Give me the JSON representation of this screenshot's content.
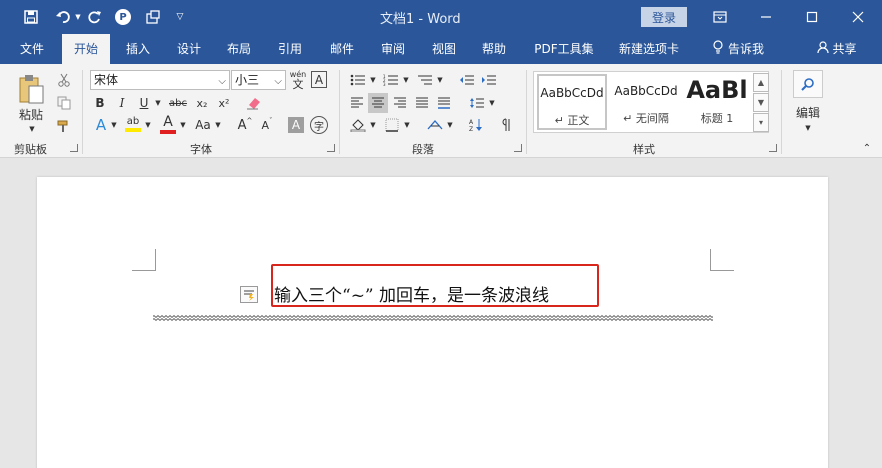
{
  "window": {
    "title": "文档1 - Word",
    "login_label": "登录"
  },
  "tabs": [
    {
      "label": "文件"
    },
    {
      "label": "开始",
      "active": true
    },
    {
      "label": "插入"
    },
    {
      "label": "设计"
    },
    {
      "label": "布局"
    },
    {
      "label": "引用"
    },
    {
      "label": "邮件"
    },
    {
      "label": "审阅"
    },
    {
      "label": "视图"
    },
    {
      "label": "帮助"
    },
    {
      "label": "PDF工具集"
    },
    {
      "label": "新建选项卡"
    },
    {
      "label": "告诉我"
    },
    {
      "label": "共享"
    }
  ],
  "ribbon": {
    "clipboard": {
      "group_label": "剪贴板",
      "paste_label": "粘贴"
    },
    "font": {
      "group_label": "字体",
      "font_name": "宋体",
      "font_size": "小三",
      "wen_label": "wén",
      "wen_char": "文",
      "a_char": "A",
      "b": "B",
      "i": "I",
      "u": "U",
      "abc": "abc",
      "sub": "x₂",
      "sup": "x²",
      "aa": "Aa",
      "zi": "字"
    },
    "paragraph": {
      "group_label": "段落"
    },
    "styles": {
      "group_label": "样式",
      "items": [
        {
          "sample": "AaBbCcDd",
          "name": "↵ 正文"
        },
        {
          "sample": "AaBbCcDd",
          "name": "↵ 无间隔"
        },
        {
          "sample": "AaBl",
          "name": "标题 1"
        }
      ]
    },
    "editing": {
      "group_label": "编辑"
    }
  },
  "document": {
    "text": "输入三个“~” 加回车，是一条波浪线"
  },
  "colors": {
    "title_bar": "#2b579a",
    "ribbon": "#f3f3f3",
    "highlight_box": "#d9261c",
    "highlight_yellow": "#ffea00",
    "font_red": "#e02020"
  }
}
